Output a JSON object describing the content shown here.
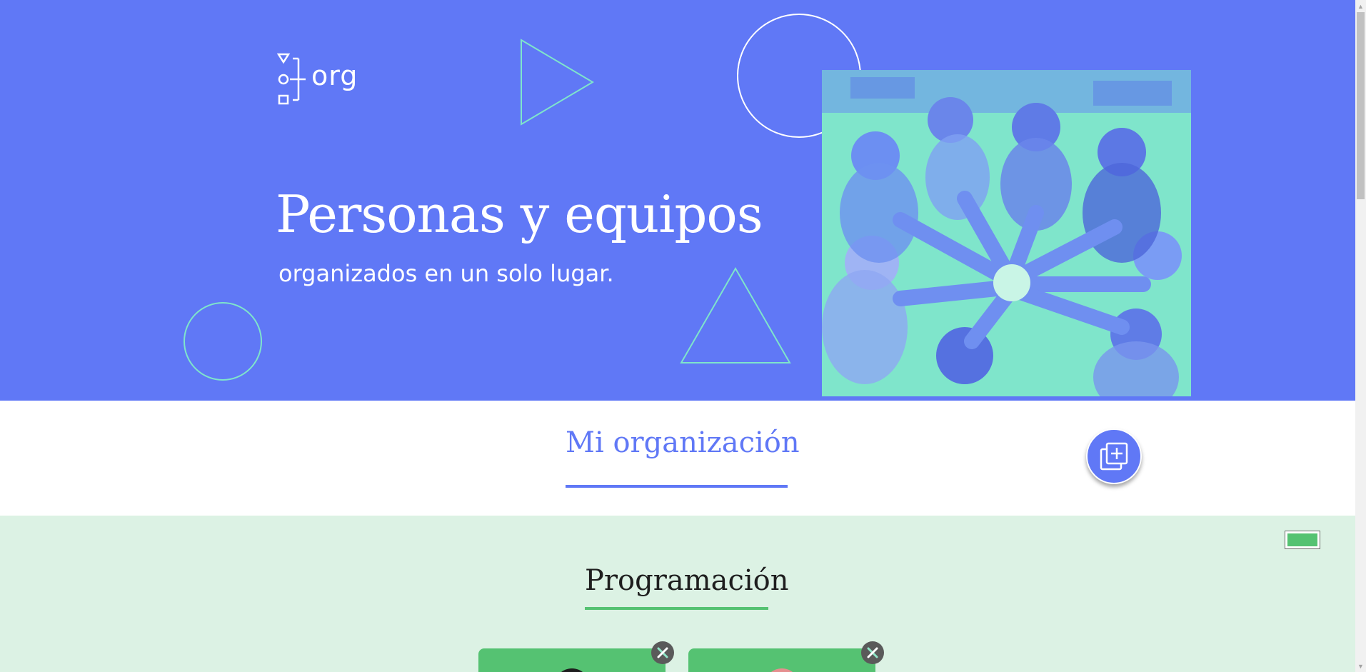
{
  "hero": {
    "logo_text": "org",
    "title": "Personas y equipos",
    "subtitle": "organizados en un solo lugar.",
    "image_alt": "team-hands-together-photo"
  },
  "organization": {
    "title": "Mi organización",
    "add_button_icon": "add-copy-icon"
  },
  "schedule": {
    "title": "Programación",
    "toggle_icon": "toggle-icon",
    "cards": [
      {
        "delete_icon": "close-icon"
      },
      {
        "delete_icon": "close-icon"
      }
    ]
  },
  "colors": {
    "primary": "#6078f6",
    "accent": "#7fe5cb",
    "green": "#55c272",
    "green_bg": "#dcf2e4"
  }
}
